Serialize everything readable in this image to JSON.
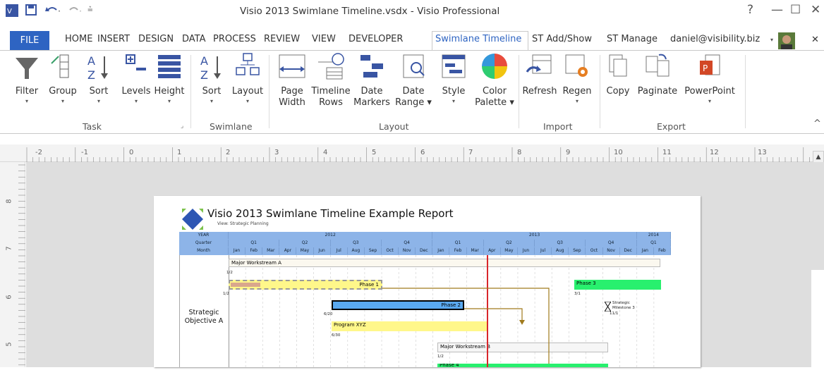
{
  "app": {
    "title": "Visio 2013 Swimlane Timeline.vsdx - Visio Professional",
    "controls": [
      "?",
      "—",
      "☐",
      "✕"
    ]
  },
  "tabs": {
    "file": "FILE",
    "items": [
      "HOME",
      "INSERT",
      "DESIGN",
      "DATA",
      "PROCESS",
      "REVIEW",
      "VIEW",
      "DEVELOPER",
      "Swimlane Timeline",
      "ST Add/Show",
      "ST Manage"
    ],
    "active": "Swimlane Timeline",
    "account": "daniel@visibility.biz",
    "close": "✕"
  },
  "ribbon": {
    "buttons": [
      {
        "l1": "Filter",
        "l2": ""
      },
      {
        "l1": "Group",
        "l2": ""
      },
      {
        "l1": "Sort",
        "l2": ""
      },
      {
        "l1": "Levels",
        "l2": ""
      },
      {
        "l1": "Height",
        "l2": ""
      },
      {
        "l1": "Sort",
        "l2": ""
      },
      {
        "l1": "Layout",
        "l2": ""
      },
      {
        "l1": "Page",
        "l2": "Width"
      },
      {
        "l1": "Timeline",
        "l2": "Rows"
      },
      {
        "l1": "Date",
        "l2": "Markers"
      },
      {
        "l1": "Date",
        "l2": "Range ▾"
      },
      {
        "l1": "Style",
        "l2": ""
      },
      {
        "l1": "Color",
        "l2": "Palette ▾"
      },
      {
        "l1": "Refresh",
        "l2": ""
      },
      {
        "l1": "Regen",
        "l2": ""
      },
      {
        "l1": "Copy",
        "l2": ""
      },
      {
        "l1": "Paginate",
        "l2": ""
      },
      {
        "l1": "PowerPoint",
        "l2": ""
      }
    ],
    "groups": [
      "Task",
      "Swimlane",
      "Layout",
      "Import",
      "Export"
    ],
    "collapse": "^"
  },
  "ruler": {
    "h": [
      "-2",
      "-1",
      "0",
      "1",
      "2",
      "3",
      "4",
      "5",
      "6",
      "7",
      "8",
      "9",
      "10",
      "11",
      "12",
      "13"
    ],
    "v": [
      "8",
      "7",
      "6",
      "5"
    ]
  },
  "report": {
    "title": "Visio 2013 Swimlane Timeline Example Report",
    "view": "View: Strategic Planning",
    "row_labels": [
      "YEAR",
      "Quarter",
      "Month"
    ],
    "years": [
      "2012",
      "2013",
      "2014"
    ],
    "quarters": [
      "Q1",
      "Q2",
      "Q3",
      "Q4",
      "Q1",
      "Q2",
      "Q3",
      "Q4",
      "Q1"
    ],
    "months": [
      "Jan",
      "Feb",
      "Mar",
      "Apr",
      "May",
      "Jun",
      "Jul",
      "Aug",
      "Sep",
      "Oct",
      "Nov",
      "Dec",
      "Jan",
      "Feb",
      "Mar",
      "Apr",
      "May",
      "Jun",
      "Jul",
      "Aug",
      "Sep",
      "Oct",
      "Nov",
      "Dec",
      "Jan",
      "Feb"
    ],
    "lane": "Strategic Objective A",
    "bars": [
      "Major Workstream A",
      "Phase 1",
      "Phase 3",
      "Phase 2",
      "Program XYZ",
      "Major Workstream B",
      "Phase 4"
    ],
    "dates": [
      "1/2",
      "1/2",
      "3/1",
      "6/20",
      "6/30",
      "1/2",
      "11/1"
    ],
    "milestone": "Strategic Milestone 3"
  }
}
